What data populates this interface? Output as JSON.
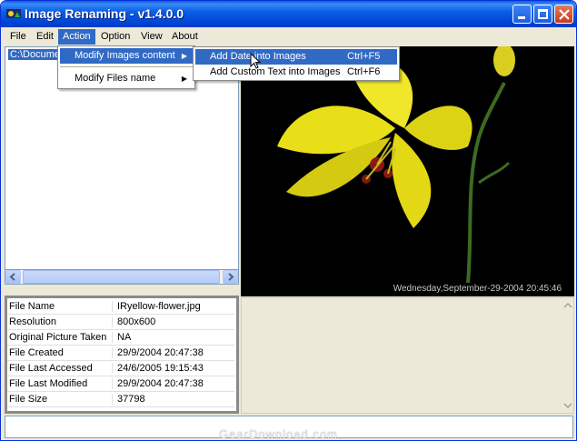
{
  "window": {
    "title": "Image Renaming - v1.4.0.0"
  },
  "menu": [
    "File",
    "Edit",
    "Action",
    "Option",
    "View",
    "About"
  ],
  "action_menu": {
    "items": [
      {
        "label": "Modify Images content"
      },
      {
        "label": "Modify Files name"
      }
    ]
  },
  "submenu": {
    "items": [
      {
        "label": "Add Date into Images",
        "shortcut": "Ctrl+F5"
      },
      {
        "label": "Add Custom Text into Images",
        "shortcut": "Ctrl+F6"
      }
    ]
  },
  "tree": {
    "path": "C:\\Docume"
  },
  "photo": {
    "caption": "Wednesday,September-29-2004  20:45:46"
  },
  "info": [
    {
      "key": "File Name",
      "value": "IRyellow-flower.jpg"
    },
    {
      "key": "Resolution",
      "value": "800x600"
    },
    {
      "key": "Original Picture Taken",
      "value": "NA"
    },
    {
      "key": "File Created",
      "value": "29/9/2004 20:47:38"
    },
    {
      "key": "File Last Accessed",
      "value": "24/6/2005 19:15:43"
    },
    {
      "key": "File Last Modified",
      "value": "29/9/2004 20:47:38"
    },
    {
      "key": "File Size",
      "value": "37798"
    }
  ],
  "watermark": "GearDownload.com",
  "colors": {
    "highlight": "#316ac5",
    "title_bar": "#0a5fe8",
    "flower": "#e8df18"
  }
}
